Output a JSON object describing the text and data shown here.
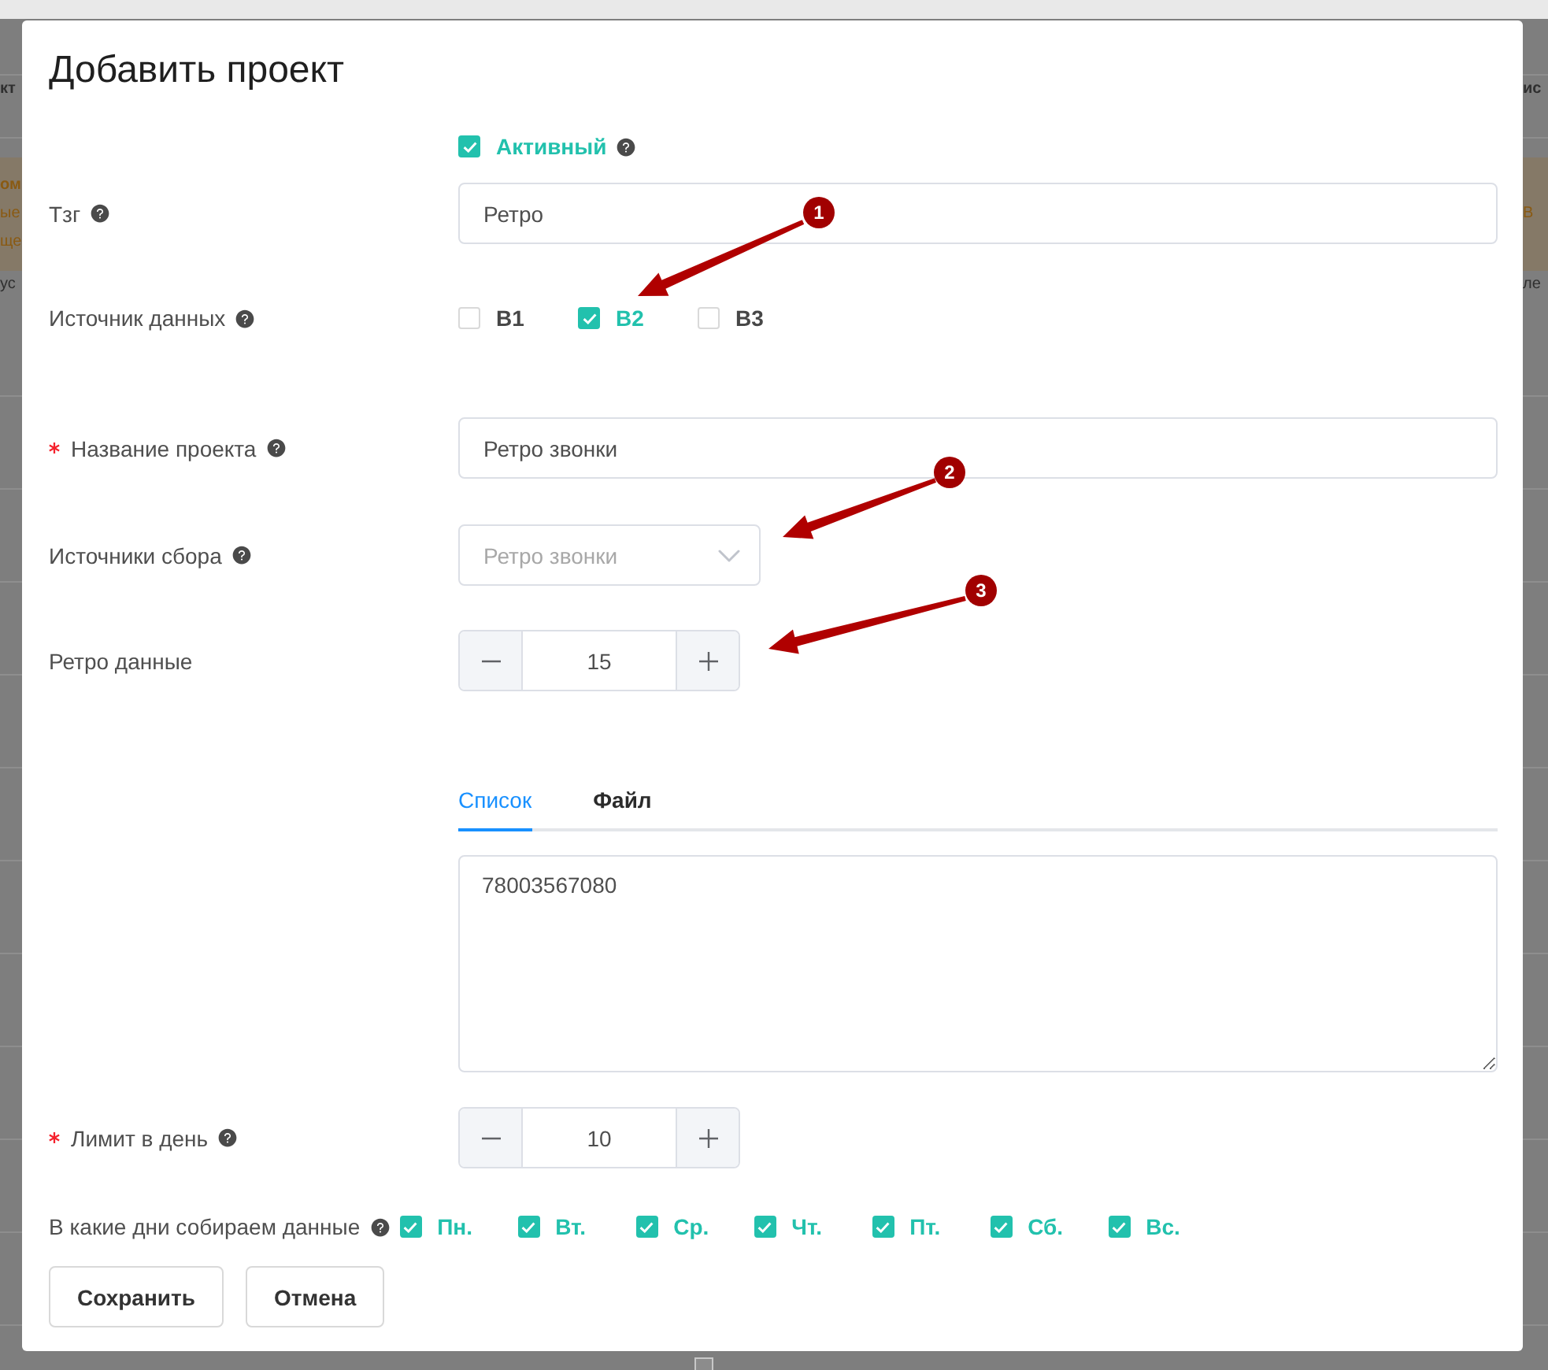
{
  "background": {
    "left_edge": [
      {
        "kind": "header",
        "text": "кт"
      },
      {
        "kind": "notice_title",
        "text": "ом"
      },
      {
        "kind": "notice",
        "text": "ые"
      },
      {
        "kind": "notice",
        "text": "ще"
      },
      {
        "kind": "cell",
        "text": "ус"
      }
    ],
    "right_edge": [
      {
        "kind": "header",
        "text": "ис"
      },
      {
        "kind": "notice",
        "text": "В"
      },
      {
        "kind": "cell",
        "text": "ле"
      }
    ],
    "bottom_checkbox": {
      "checked": false
    }
  },
  "dialog": {
    "title": "Добавить проект"
  },
  "form": {
    "fields": [
      {
        "kind": "checkbox",
        "label": "Активный",
        "checked": true,
        "help": true
      },
      {
        "kind": "text",
        "label": "Тзг",
        "help": true,
        "value": "Ретро"
      },
      {
        "kind": "checkbox_group",
        "label": "Источник данных",
        "help": true,
        "options": [
          {
            "label": "B1",
            "checked": false
          },
          {
            "label": "B2",
            "checked": true
          },
          {
            "label": "B3",
            "checked": false
          }
        ]
      },
      {
        "kind": "text",
        "label": "Название проекта",
        "required": true,
        "help": true,
        "value": "Ретро звонки"
      },
      {
        "kind": "select",
        "label": "Источники сбора",
        "help": true,
        "placeholder": "Ретро звонки"
      },
      {
        "kind": "number",
        "label": "Ретро данные",
        "value": "15"
      },
      {
        "kind": "tabs",
        "tabs": [
          {
            "label": "Список",
            "selected": true
          },
          {
            "label": "Файл",
            "selected": false
          }
        ],
        "textarea": {
          "value": "78003567080"
        }
      },
      {
        "kind": "number",
        "label": "Лимит в день",
        "required": true,
        "help": true,
        "value": "10"
      },
      {
        "kind": "days",
        "label": "В какие дни собираем данные",
        "help": true,
        "options": [
          {
            "label": "Пн.",
            "checked": true
          },
          {
            "label": "Вт.",
            "checked": true
          },
          {
            "label": "Ср.",
            "checked": true
          },
          {
            "label": "Чт.",
            "checked": true
          },
          {
            "label": "Пт.",
            "checked": true
          },
          {
            "label": "Сб.",
            "checked": true
          },
          {
            "label": "Вс.",
            "checked": true
          }
        ]
      }
    ]
  },
  "buttons": [
    {
      "label": "Сохранить"
    },
    {
      "label": "Отмена"
    }
  ],
  "annotations": [
    {
      "number": "1"
    },
    {
      "number": "2"
    },
    {
      "number": "3"
    }
  ]
}
